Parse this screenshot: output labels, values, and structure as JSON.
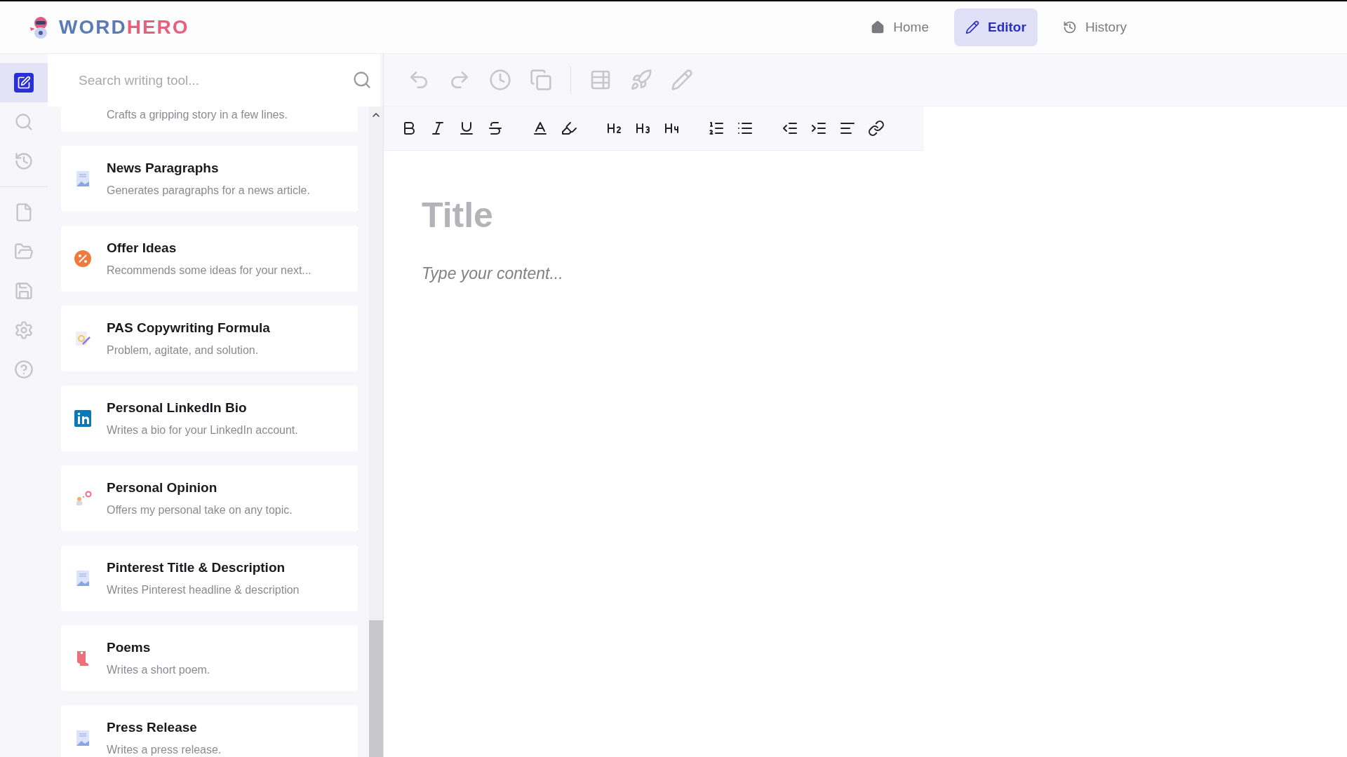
{
  "logo": {
    "part_1": "WORD",
    "part_2": "HERO"
  },
  "nav": [
    {
      "label": "Home",
      "kind": "home",
      "selected": false
    },
    {
      "label": "Editor",
      "kind": "editor",
      "selected": true
    },
    {
      "label": "History",
      "kind": "history",
      "selected": false
    }
  ],
  "rail": [
    {
      "kind": "editor",
      "selected": true
    },
    {
      "kind": "search",
      "selected": false
    },
    {
      "kind": "history",
      "selected": false
    },
    {
      "kind": "new",
      "selected": false
    },
    {
      "kind": "open",
      "selected": false
    },
    {
      "kind": "save",
      "selected": false
    },
    {
      "kind": "settings",
      "selected": false
    },
    {
      "kind": "help",
      "selected": false
    }
  ],
  "search": {
    "placeholder": "Search writing tool..."
  },
  "tools": [
    {
      "description": "Crafts a gripping story in a few lines.",
      "kind": "partial"
    },
    {
      "title": "News Paragraphs",
      "description": "Generates paragraphs for a news article.",
      "kind": "document"
    },
    {
      "title": "Offer Ideas",
      "description": "Recommends some ideas for your next...",
      "kind": "offer"
    },
    {
      "title": "PAS Copywriting Formula",
      "description": "Problem, agitate, and solution.",
      "kind": "formula"
    },
    {
      "title": "Personal LinkedIn Bio",
      "description": "Writes a bio for your LinkedIn account.",
      "kind": "social"
    },
    {
      "title": "Personal Opinion",
      "description": "Offers my personal take on any topic.",
      "kind": "opinion"
    },
    {
      "title": "Pinterest Title & Description",
      "description": "Writes Pinterest headline & description",
      "kind": "document"
    },
    {
      "title": "Poems",
      "description": "Writes a short poem.",
      "kind": "poem"
    },
    {
      "title": "Press Release",
      "description": "Writes a press release.",
      "kind": "document"
    }
  ],
  "editor": {
    "title_placeholder": "Title",
    "content_placeholder": "Type your content..."
  }
}
